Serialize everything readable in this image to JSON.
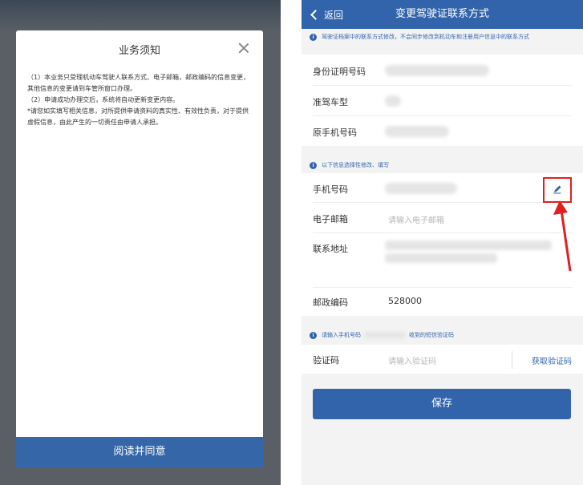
{
  "left": {
    "modal_title": "业务须知",
    "paragraphs": [
      "（1）本业务只受理机动车驾驶人联系方式、电子邮箱，邮政编码的信息变更，其他信息的变更请到车管所窗口办理。",
      "（2）申请成功办理交后，系统将自动更新变更内容。",
      "*请您如实填写相关信息，对所提供申请资料的真实性、有效性负责，对于提供虚假信息，由此产生的一切责任由申请人承担。"
    ],
    "agree_label": "阅读并同意"
  },
  "right": {
    "back_label": "返回",
    "title": "变更驾驶证联系方式",
    "notice_top": "驾驶证档案中的联系方式修改，不会同步修改到机动车和注册用户信息中的联系方式",
    "fields_fixed": [
      {
        "label": "身份证明号码"
      },
      {
        "label": "准驾车型"
      },
      {
        "label": "原手机号码"
      }
    ],
    "notice_mid": "以下信息选择性修改、填写",
    "phone_label": "手机号码",
    "email_label": "电子邮箱",
    "email_placeholder": "请输入电子邮箱",
    "address_label": "联系地址",
    "postcode_label": "邮政编码",
    "postcode_value": "528000",
    "notice_code_prefix": "请输入手机号码",
    "notice_code_suffix": "收到的短信验证码",
    "code_label": "验证码",
    "code_placeholder": "请输入验证码",
    "get_code_label": "获取验证码",
    "save_label": "保存"
  },
  "colors": {
    "brand_blue": "#3264ab",
    "annotation_red": "#e02020"
  }
}
